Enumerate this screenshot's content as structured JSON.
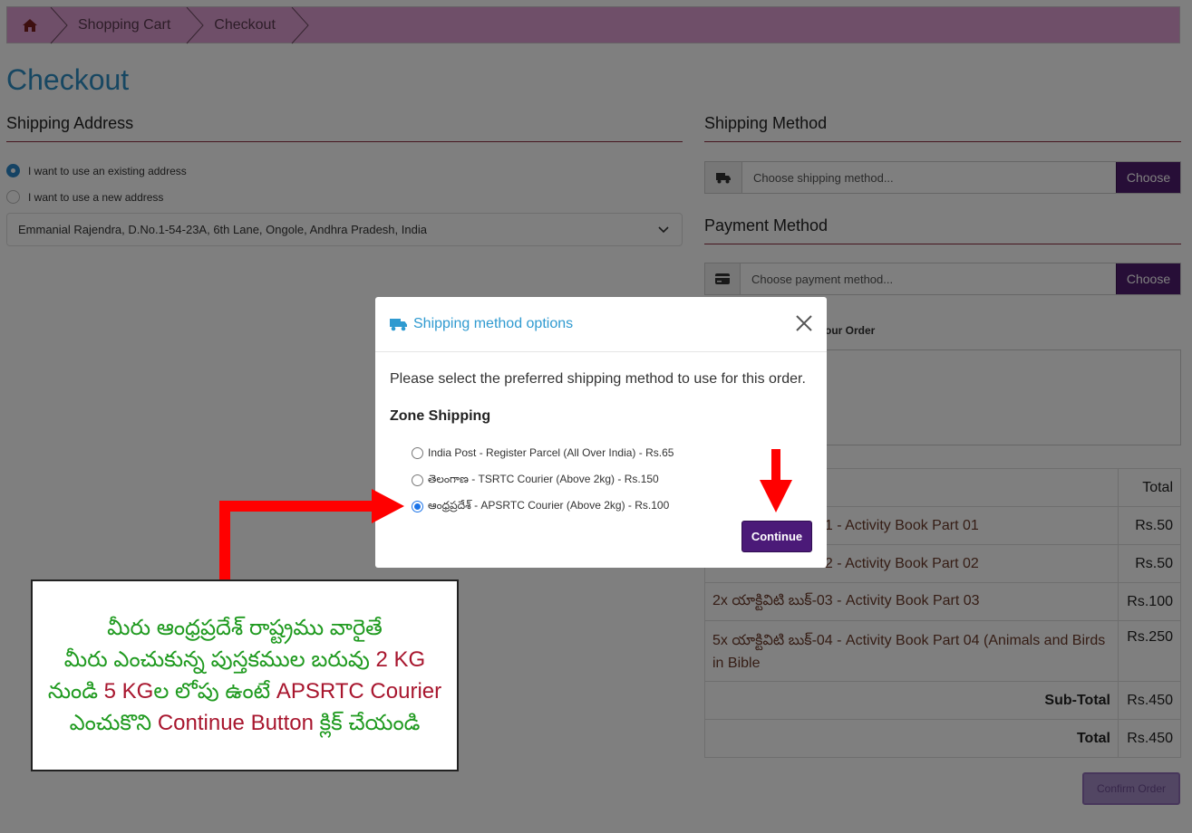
{
  "breadcrumb": {
    "items": [
      "Shopping Cart",
      "Checkout"
    ]
  },
  "page_title": "Checkout",
  "shipping_address": {
    "title": "Shipping Address",
    "existing_label": "I want to use an existing address",
    "new_label": "I want to use a new address",
    "selected_address": "Emmanial Rajendra, D.No.1-54-23A, 6th Lane, Ongole, Andhra Pradesh, India"
  },
  "shipping_method": {
    "title": "Shipping Method",
    "placeholder": "Choose shipping method...",
    "button": "Choose"
  },
  "payment_method": {
    "title": "Payment Method",
    "placeholder": "Choose payment method...",
    "button": "Choose"
  },
  "comment_label": "our Order",
  "order_table": {
    "header_total": "Total",
    "rows": [
      {
        "product": "01 - Activity Book Part 01",
        "amount": "Rs.50"
      },
      {
        "product": "02 - Activity Book Part 02",
        "amount": "Rs.50"
      },
      {
        "product": "2x యాక్టివిటి బుక్-03 - Activity Book Part 03",
        "amount": "Rs.100"
      },
      {
        "product": "5x యాక్టివిటి బుక్-04 - Activity Book Part 04 (Animals and Birds in Bible",
        "amount": "Rs.250"
      }
    ],
    "subtotal_label": "Sub-Total",
    "subtotal_value": "Rs.450",
    "total_label": "Total",
    "total_value": "Rs.450"
  },
  "confirm_button": "Confirm Order",
  "modal": {
    "title": "Shipping method options",
    "description": "Please select the preferred shipping method to use for this order.",
    "zone_title": "Zone Shipping",
    "options": [
      {
        "label": "India Post - Register Parcel (All Over India) - Rs.65",
        "checked": false
      },
      {
        "label": "తెలంగాణ - TSRTC Courier (Above 2kg) - Rs.150",
        "checked": false
      },
      {
        "label": "ఆంధ్రప్రదేశ్ - APSRTC Courier (Above 2kg) - Rs.100",
        "checked": true
      }
    ],
    "continue_button": "Continue"
  },
  "callout": {
    "line1": "మీరు ఆంధ్రప్రదేశ్ రాష్ట్రము వారైతే",
    "line2_a": "మీరు ఎంచుకున్న పుస్తకముల బరువు",
    "line2_b": " 2 KG",
    "line3_a": "నుండి",
    "line3_b": " 5 KG",
    "line3_c": "ల లోపు ఉంటే ",
    "line3_d": " APSRTC Courier",
    "line4_a": "ఎంచుకొని ",
    "line4_b": "Continue Button",
    "line4_c": " క్లిక్ చేయండి"
  },
  "colors": {
    "breadcrumb_bg": "#df9ed2",
    "title_blue": "#2f8fc5",
    "button_purple": "#4e1c6e",
    "arrow_red": "#ff0000",
    "callout_green": "#1f9a1f",
    "callout_red": "#a8162e"
  }
}
